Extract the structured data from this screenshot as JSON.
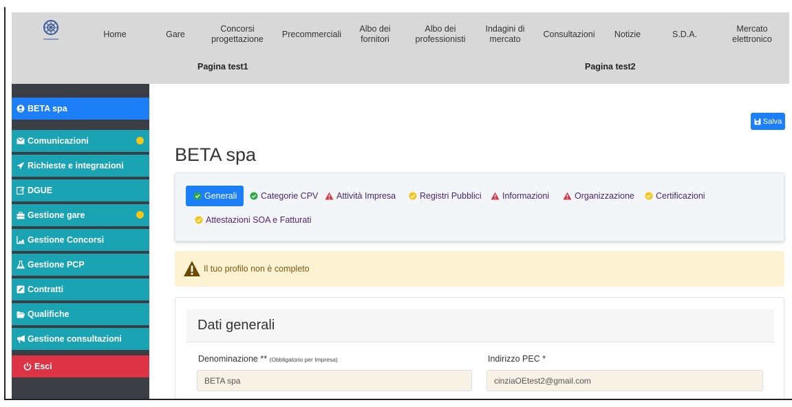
{
  "nav": {
    "items": [
      {
        "label": "Home"
      },
      {
        "label": "Gare"
      },
      {
        "label": "Concorsi progettazione"
      },
      {
        "label": "Precommerciali"
      },
      {
        "label": "Albo dei fornitori"
      },
      {
        "label": "Albo dei professionisti"
      },
      {
        "label": "Indagini di mercato"
      },
      {
        "label": "Consultazioni"
      },
      {
        "label": "Notizie"
      },
      {
        "label": "S.D.A."
      },
      {
        "label": "Mercato elettronico"
      }
    ],
    "subpages": [
      {
        "label": "Pagina test1"
      },
      {
        "label": "Pagina test2"
      }
    ]
  },
  "sidebar": {
    "user": {
      "label": "BETA spa",
      "icon": "user-circle-icon"
    },
    "items": [
      {
        "label": "Comunicazioni",
        "icon": "envelope-icon",
        "dot": true
      },
      {
        "label": "Richieste e integrazioni",
        "icon": "paper-plane-icon",
        "dot": false
      },
      {
        "label": "DGUE",
        "icon": "edit-icon",
        "dot": false
      },
      {
        "label": "Gestione gare",
        "icon": "briefcase-icon",
        "dot": true
      },
      {
        "label": "Gestione Concorsi",
        "icon": "chart-area-icon",
        "dot": false
      },
      {
        "label": "Gestione PCP",
        "icon": "flask-icon",
        "dot": false
      },
      {
        "label": "Contratti",
        "icon": "pen-square-icon",
        "dot": false
      },
      {
        "label": "Qualifiche",
        "icon": "folder-open-icon",
        "dot": false
      },
      {
        "label": "Gestione consultazioni",
        "icon": "bullhorn-icon",
        "dot": false
      }
    ],
    "logout": {
      "label": "Esci",
      "icon": "power-icon"
    }
  },
  "main": {
    "save_label": "Salva",
    "title": "BETA spa",
    "tabs": [
      {
        "label": "Generali",
        "status": "ok",
        "active": true
      },
      {
        "label": "Categorie CPV",
        "status": "ok",
        "active": false
      },
      {
        "label": "Attività Impresa",
        "status": "error",
        "active": false
      },
      {
        "label": "Registri Pubblici",
        "status": "warn",
        "active": false
      },
      {
        "label": "Informazioni",
        "status": "error",
        "active": false
      },
      {
        "label": "Organizzazione",
        "status": "error",
        "active": false
      },
      {
        "label": "Certificazioni",
        "status": "warn",
        "active": false
      },
      {
        "label": "Attestazioni SOA e Fatturati",
        "status": "warn",
        "active": false
      }
    ],
    "alert": "Il tuo profilo non è completo",
    "section_title": "Dati generali",
    "fields": {
      "denominazione": {
        "label": "Denominazione **",
        "hint": "(Obbligatorio per Impresa)",
        "value": "BETA spa"
      },
      "pec": {
        "label": "Indirizzo PEC *",
        "value": "cinziaOEtest2@gmail.com"
      }
    }
  },
  "colors": {
    "primary": "#1d7ff7",
    "sidebar_item": "#1aa3b3",
    "sidebar_bg": "#3b3e44",
    "logout": "#dd3344",
    "ok": "#28a745",
    "error": "#dc3545",
    "warn": "#f5c518"
  }
}
